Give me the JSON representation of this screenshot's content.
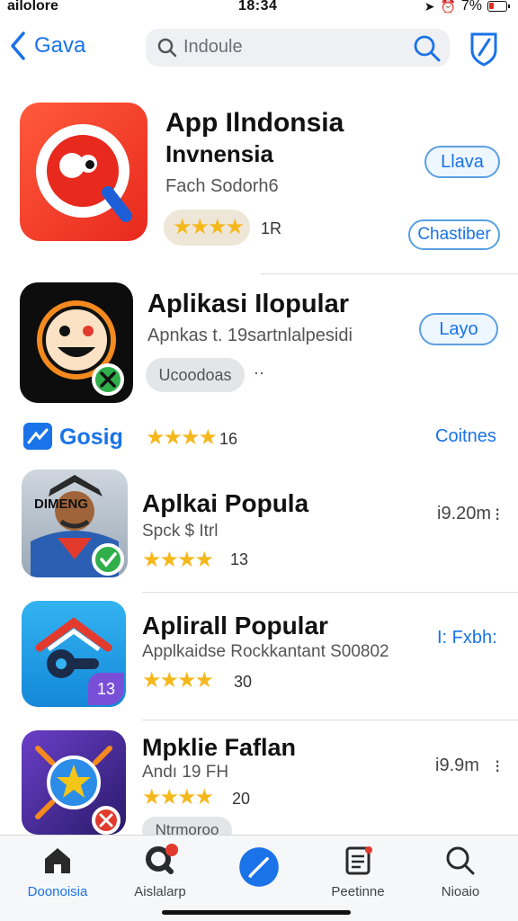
{
  "status_bar": {
    "carrier": "ailolore",
    "time": "18:34",
    "battery": "7%"
  },
  "nav": {
    "back_label": "Gava",
    "search_text": "Indoule"
  },
  "apps": [
    {
      "title": "App  Ilndonsia",
      "title2": "Invnensia",
      "sub": "Fach Sodorh6",
      "count": "1R",
      "btn1": "Llava",
      "btn2": "Chastiber",
      "stars": "★★★★"
    },
    {
      "title": "Aplikasi Ilopular",
      "sub": "Apnkas t. 19sartnlalpesidi",
      "pill": "Ucoodoas",
      "dots": "··",
      "btn": "Layo"
    },
    {
      "brand": "Gosig",
      "stars": "★★★★",
      "count": "16",
      "link": "Coitnes"
    },
    {
      "title": "Aplkai Popula",
      "sub": "Spck $ Itrl",
      "stars": "★★★★",
      "count": "13",
      "side": "i9.20m",
      "side_mark": "⁝",
      "icon_text": "DIMENG"
    },
    {
      "title": "Aplirall Popular",
      "sub": "Applkaidse  Rockkantant S00802",
      "stars": "★★★★",
      "count": "30",
      "side": "I: Fxbh:",
      "badge": "13"
    },
    {
      "title": "Mpklie Faflan",
      "sub": "Andı 19 FH",
      "stars": "★★★★",
      "count": "20",
      "side": "i9.9m",
      "side_mark": "⁝",
      "pill": "Ntrmoroo"
    }
  ],
  "tabs": [
    {
      "label": "Doonoisia"
    },
    {
      "label": "Aislalarp",
      "badge": "1"
    },
    {
      "label": ""
    },
    {
      "label": "Peetinne"
    },
    {
      "label": "Nioaio"
    }
  ],
  "colors": {
    "accent": "#1a73e8",
    "star": "#f5b81c",
    "green": "#2fae4a",
    "red": "#e23b2e"
  }
}
